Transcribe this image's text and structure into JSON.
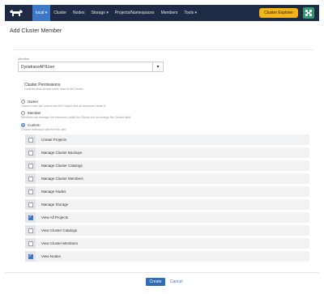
{
  "nav": {
    "cluster_selector": "local",
    "items": [
      "Cluster",
      "Nodes",
      "Storage",
      "Projects/Namespaces",
      "Members",
      "Tools"
    ],
    "explorer_button": "Cluster Explorer",
    "accent": "#3d78c7",
    "bar_color": "#1f2a44"
  },
  "page": {
    "title": "Add Cluster Member"
  },
  "member": {
    "label": "Member",
    "value": "DynatraceAPIUser"
  },
  "permissions": {
    "title": "Cluster Permissions",
    "subtitle": "Controls what access users have to the Cluster",
    "options": [
      {
        "label": "Owner",
        "desc": "Owners have full control over the Cluster and all resources inside it."
      },
      {
        "label": "Member",
        "desc": "Members can manage the resources inside the Cluster but not change the Cluster itself."
      },
      {
        "label": "Custom",
        "desc": "Choose individual roles for this user."
      }
    ],
    "selected": "Custom"
  },
  "roles": [
    {
      "label": "Create Projects",
      "checked": false
    },
    {
      "label": "Manage Cluster Backups",
      "checked": false
    },
    {
      "label": "Manage Cluster Catalogs",
      "checked": false
    },
    {
      "label": "Manage Cluster Members",
      "checked": false
    },
    {
      "label": "Manage Nodes",
      "checked": false
    },
    {
      "label": "Manage Storage",
      "checked": false
    },
    {
      "label": "View All Projects",
      "checked": true
    },
    {
      "label": "View Cluster Catalogs",
      "checked": false
    },
    {
      "label": "View Cluster Members",
      "checked": false
    },
    {
      "label": "View Nodes",
      "checked": true
    }
  ],
  "actions": {
    "create": "Create",
    "cancel": "Cancel"
  }
}
